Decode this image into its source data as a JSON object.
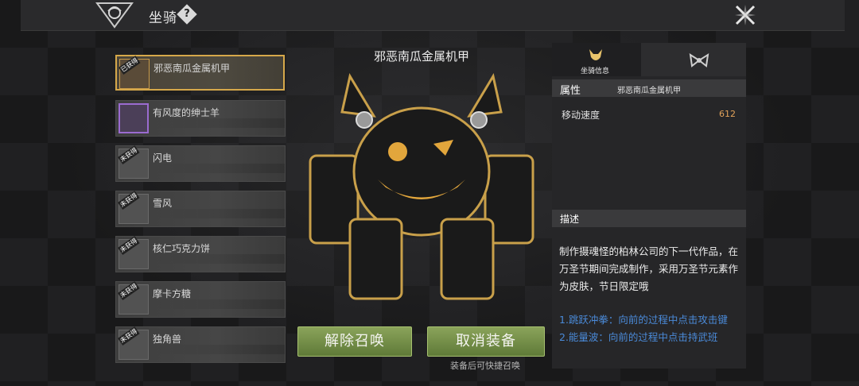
{
  "header": {
    "title": "坐骑",
    "help_label": "?"
  },
  "mounts": [
    {
      "name": "邪恶南瓜金属机甲",
      "badge": "已获得",
      "selected": true
    },
    {
      "name": "有风度的绅士羊",
      "badge": ""
    },
    {
      "name": "闪电",
      "badge": "未获得"
    },
    {
      "name": "雪风",
      "badge": "未获得"
    },
    {
      "name": "核仁巧克力饼",
      "badge": "未获得"
    },
    {
      "name": "摩卡方糖",
      "badge": "未获得"
    },
    {
      "name": "独角兽",
      "badge": "未获得"
    }
  ],
  "preview": {
    "title": "邪恶南瓜金属机甲",
    "dismiss_label": "解除召唤",
    "unequip_label": "取消装备",
    "hint": "装备后可快捷召唤"
  },
  "info": {
    "tab_mount_info": "坐骑信息",
    "attr_title": "属性",
    "attr_name": "邪恶南瓜金属机甲",
    "stat_label": "移动速度",
    "stat_value": "612",
    "desc_title": "描述",
    "desc_text": "制作摄魂怪的柏林公司的下一代作品，在万圣节期间完成制作，采用万圣节元素作为皮肤，节日限定哦",
    "skill_text": "1.跳跃冲拳：向前的过程中点击攻击键\n2.能量波：向前的过程中点击持武班"
  },
  "colors": {
    "accent_gold": "#d6a84a",
    "button_green": "#7a9548",
    "stat_orange": "#e2a25a",
    "link_blue": "#4a8ad8"
  },
  "icons": [
    "dragon-emblem-icon",
    "close-icon",
    "mount-info-icon",
    "bow-icon"
  ]
}
